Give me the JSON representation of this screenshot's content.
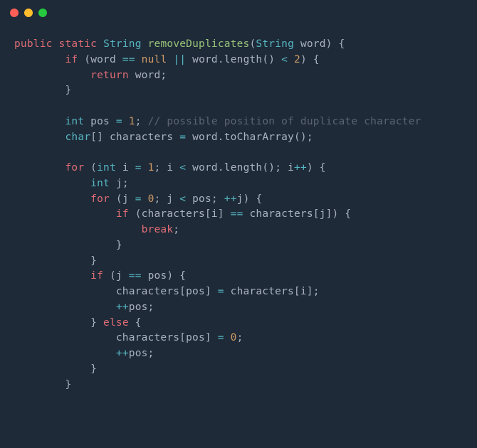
{
  "theme": {
    "bg": "#1e2a38",
    "dot_red": "#ff5f56",
    "dot_yellow": "#ffbd2e",
    "dot_green": "#27c93f",
    "kw": "#e06c75",
    "type": "#56b6c2",
    "fn": "#98c379",
    "num": "#d19a66",
    "op": "#56b6c2",
    "comment": "#5c6370",
    "txt": "#abb2bf"
  },
  "code": {
    "tokens": [
      [
        {
          "c": "kw",
          "t": "public"
        },
        {
          "c": "txt",
          "t": " "
        },
        {
          "c": "kw",
          "t": "static"
        },
        {
          "c": "txt",
          "t": " "
        },
        {
          "c": "type",
          "t": "String"
        },
        {
          "c": "txt",
          "t": " "
        },
        {
          "c": "fn",
          "t": "removeDuplicates"
        },
        {
          "c": "txt",
          "t": "("
        },
        {
          "c": "type",
          "t": "String"
        },
        {
          "c": "txt",
          "t": " word) {"
        }
      ],
      [
        {
          "c": "txt",
          "t": "        "
        },
        {
          "c": "kw",
          "t": "if"
        },
        {
          "c": "txt",
          "t": " (word "
        },
        {
          "c": "op",
          "t": "=="
        },
        {
          "c": "txt",
          "t": " "
        },
        {
          "c": "num",
          "t": "null"
        },
        {
          "c": "txt",
          "t": " "
        },
        {
          "c": "op",
          "t": "||"
        },
        {
          "c": "txt",
          "t": " word.length() "
        },
        {
          "c": "op",
          "t": "<"
        },
        {
          "c": "txt",
          "t": " "
        },
        {
          "c": "num",
          "t": "2"
        },
        {
          "c": "txt",
          "t": ") {"
        }
      ],
      [
        {
          "c": "txt",
          "t": "            "
        },
        {
          "c": "kw",
          "t": "return"
        },
        {
          "c": "txt",
          "t": " word;"
        }
      ],
      [
        {
          "c": "txt",
          "t": "        }"
        }
      ],
      [
        {
          "c": "txt",
          "t": ""
        }
      ],
      [
        {
          "c": "txt",
          "t": "        "
        },
        {
          "c": "type",
          "t": "int"
        },
        {
          "c": "txt",
          "t": " pos "
        },
        {
          "c": "op",
          "t": "="
        },
        {
          "c": "txt",
          "t": " "
        },
        {
          "c": "num",
          "t": "1"
        },
        {
          "c": "txt",
          "t": "; "
        },
        {
          "c": "comment",
          "t": "// possible position of duplicate character"
        }
      ],
      [
        {
          "c": "txt",
          "t": "        "
        },
        {
          "c": "type",
          "t": "char"
        },
        {
          "c": "txt",
          "t": "[] characters "
        },
        {
          "c": "op",
          "t": "="
        },
        {
          "c": "txt",
          "t": " word.toCharArray();"
        }
      ],
      [
        {
          "c": "txt",
          "t": ""
        }
      ],
      [
        {
          "c": "txt",
          "t": "        "
        },
        {
          "c": "kw",
          "t": "for"
        },
        {
          "c": "txt",
          "t": " ("
        },
        {
          "c": "type",
          "t": "int"
        },
        {
          "c": "txt",
          "t": " i "
        },
        {
          "c": "op",
          "t": "="
        },
        {
          "c": "txt",
          "t": " "
        },
        {
          "c": "num",
          "t": "1"
        },
        {
          "c": "txt",
          "t": "; i "
        },
        {
          "c": "op",
          "t": "<"
        },
        {
          "c": "txt",
          "t": " word.length(); i"
        },
        {
          "c": "op",
          "t": "++"
        },
        {
          "c": "txt",
          "t": ") {"
        }
      ],
      [
        {
          "c": "txt",
          "t": "            "
        },
        {
          "c": "type",
          "t": "int"
        },
        {
          "c": "txt",
          "t": " j;"
        }
      ],
      [
        {
          "c": "txt",
          "t": "            "
        },
        {
          "c": "kw",
          "t": "for"
        },
        {
          "c": "txt",
          "t": " (j "
        },
        {
          "c": "op",
          "t": "="
        },
        {
          "c": "txt",
          "t": " "
        },
        {
          "c": "num",
          "t": "0"
        },
        {
          "c": "txt",
          "t": "; j "
        },
        {
          "c": "op",
          "t": "<"
        },
        {
          "c": "txt",
          "t": " pos; "
        },
        {
          "c": "op",
          "t": "++"
        },
        {
          "c": "txt",
          "t": "j) {"
        }
      ],
      [
        {
          "c": "txt",
          "t": "                "
        },
        {
          "c": "kw",
          "t": "if"
        },
        {
          "c": "txt",
          "t": " (characters[i] "
        },
        {
          "c": "op",
          "t": "=="
        },
        {
          "c": "txt",
          "t": " characters[j]) {"
        }
      ],
      [
        {
          "c": "txt",
          "t": "                    "
        },
        {
          "c": "kw",
          "t": "break"
        },
        {
          "c": "txt",
          "t": ";"
        }
      ],
      [
        {
          "c": "txt",
          "t": "                }"
        }
      ],
      [
        {
          "c": "txt",
          "t": "            }"
        }
      ],
      [
        {
          "c": "txt",
          "t": "            "
        },
        {
          "c": "kw",
          "t": "if"
        },
        {
          "c": "txt",
          "t": " (j "
        },
        {
          "c": "op",
          "t": "=="
        },
        {
          "c": "txt",
          "t": " pos) {"
        }
      ],
      [
        {
          "c": "txt",
          "t": "                characters[pos] "
        },
        {
          "c": "op",
          "t": "="
        },
        {
          "c": "txt",
          "t": " characters[i];"
        }
      ],
      [
        {
          "c": "txt",
          "t": "                "
        },
        {
          "c": "op",
          "t": "++"
        },
        {
          "c": "txt",
          "t": "pos;"
        }
      ],
      [
        {
          "c": "txt",
          "t": "            } "
        },
        {
          "c": "kw",
          "t": "else"
        },
        {
          "c": "txt",
          "t": " {"
        }
      ],
      [
        {
          "c": "txt",
          "t": "                characters[pos] "
        },
        {
          "c": "op",
          "t": "="
        },
        {
          "c": "txt",
          "t": " "
        },
        {
          "c": "num",
          "t": "0"
        },
        {
          "c": "txt",
          "t": ";"
        }
      ],
      [
        {
          "c": "txt",
          "t": "                "
        },
        {
          "c": "op",
          "t": "++"
        },
        {
          "c": "txt",
          "t": "pos;"
        }
      ],
      [
        {
          "c": "txt",
          "t": "            }"
        }
      ],
      [
        {
          "c": "txt",
          "t": "        }"
        }
      ]
    ]
  }
}
